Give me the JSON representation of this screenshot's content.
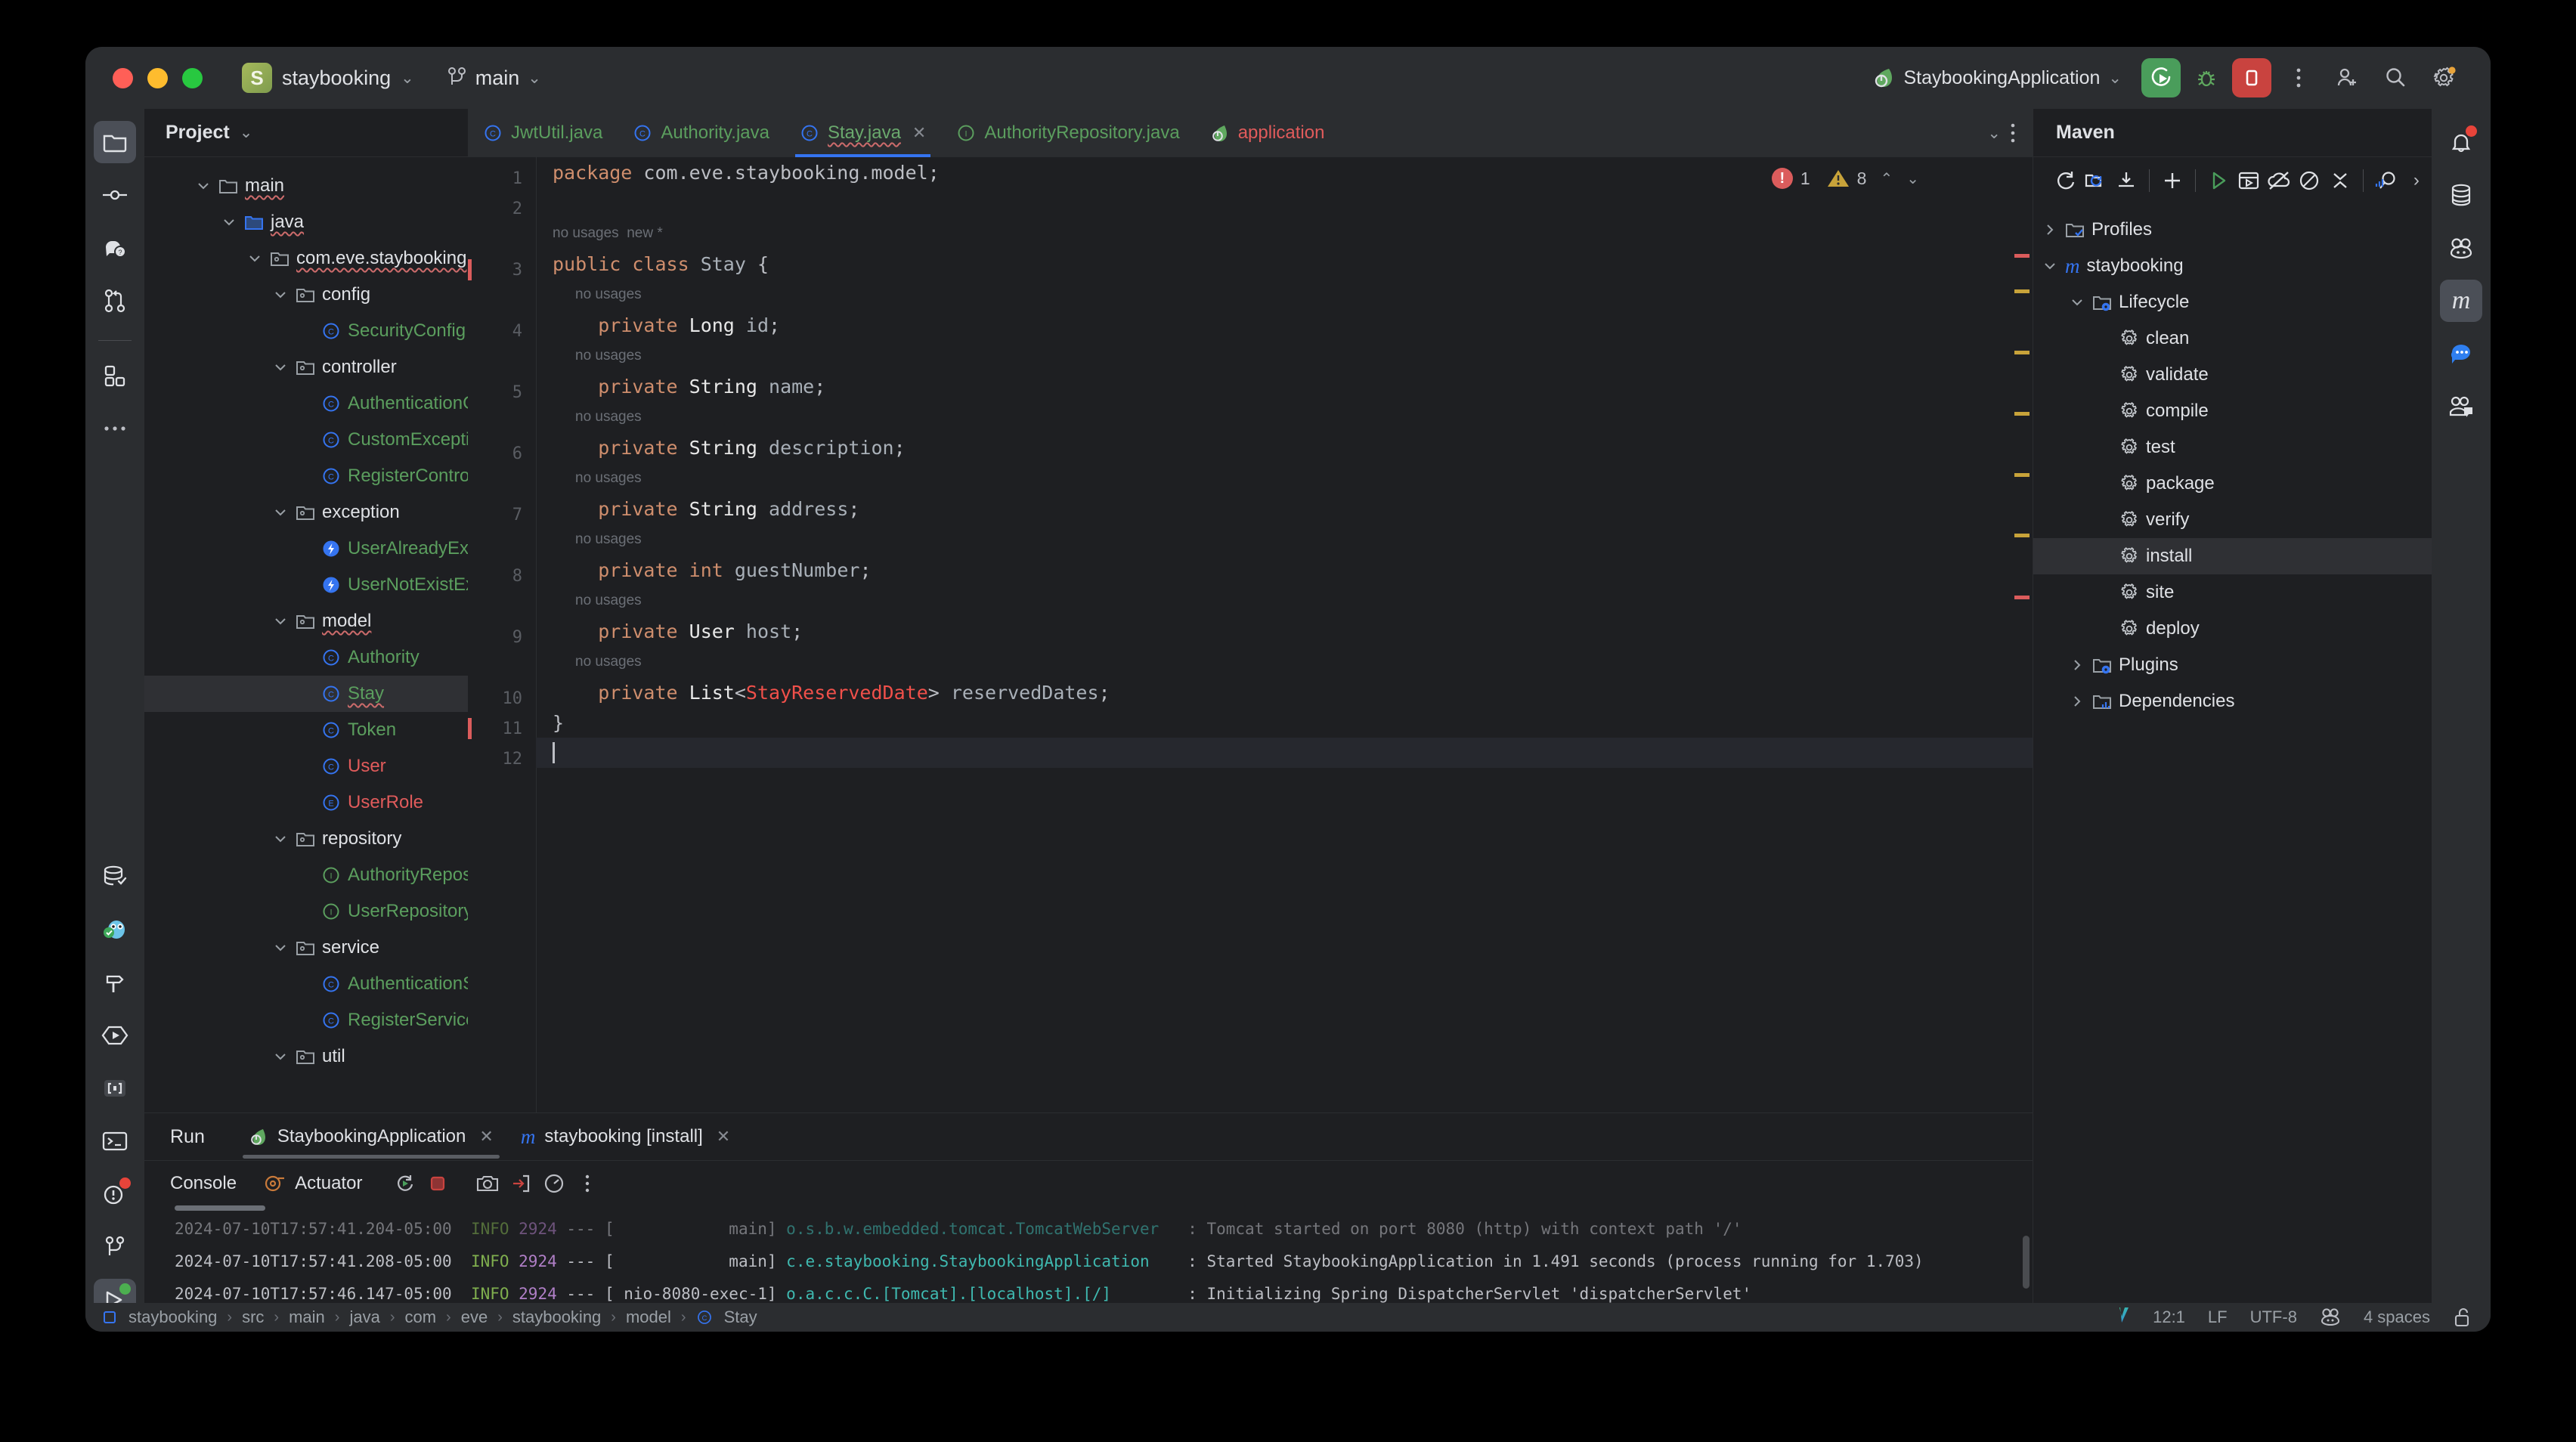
{
  "window": {
    "project_name": "staybooking",
    "project_badge": "S",
    "branch": "main",
    "run_config": "StaybookingApplication"
  },
  "titlebar": {
    "icons": [
      {
        "name": "run-button",
        "label": "Run"
      },
      {
        "name": "debug-button",
        "label": "Debug"
      },
      {
        "name": "stop-button",
        "label": "Stop"
      },
      {
        "name": "more-actions-button",
        "label": "More"
      },
      {
        "name": "add-collaborator-icon",
        "label": "Code With Me"
      },
      {
        "name": "search-everywhere-icon",
        "label": "Search"
      },
      {
        "name": "settings-icon",
        "label": "Settings"
      }
    ]
  },
  "left_activity_bar": {
    "items": [
      {
        "name": "project-tool-icon",
        "label": "Project",
        "active": true
      },
      {
        "name": "commit-tool-icon",
        "label": "Commit",
        "active": false
      },
      {
        "name": "ai-assistant-icon",
        "label": "AI Assistant",
        "active": false
      },
      {
        "name": "pull-requests-icon",
        "label": "Pull Requests",
        "active": false
      },
      {
        "name": "structure-icon",
        "label": "Structure",
        "active": false
      },
      {
        "name": "more-tool-windows-icon",
        "label": "More Tool Windows",
        "active": false
      },
      {
        "name": "database-icon",
        "label": "Database",
        "active": false
      },
      {
        "name": "endpoints-icon",
        "label": "Endpoints",
        "active": false
      },
      {
        "name": "build-icon",
        "label": "Build",
        "active": false
      },
      {
        "name": "services-icon",
        "label": "Services",
        "active": false
      },
      {
        "name": "bookmarks-icon",
        "label": "Bookmarks",
        "active": false
      },
      {
        "name": "terminal-icon",
        "label": "Terminal",
        "active": false
      },
      {
        "name": "problems-icon",
        "label": "Problems",
        "active": false
      },
      {
        "name": "version-control-icon",
        "label": "Version Control",
        "active": false
      },
      {
        "name": "run-tool-icon",
        "label": "Run",
        "active": true
      }
    ]
  },
  "right_activity_bar": {
    "items": [
      {
        "name": "notifications-icon",
        "label": "Notifications",
        "active": false
      },
      {
        "name": "database-panel-icon",
        "label": "Database",
        "active": false
      },
      {
        "name": "bot-icon",
        "label": "Assistant",
        "active": false
      },
      {
        "name": "maven-panel-icon",
        "label": "Maven",
        "active": true
      },
      {
        "name": "chat-icon",
        "label": "Chat",
        "active": false
      },
      {
        "name": "ai-chat-icon",
        "label": "AI Chat",
        "active": false
      }
    ]
  },
  "project_panel": {
    "title": "Project",
    "tree": [
      {
        "label": "main",
        "icon": "folder",
        "depth": 2,
        "expanded": true,
        "color": "white",
        "squiggle": true
      },
      {
        "label": "java",
        "icon": "folder-source",
        "depth": 3,
        "expanded": true,
        "color": "white",
        "squiggle": true
      },
      {
        "label": "com.eve.staybooking",
        "icon": "package",
        "depth": 4,
        "expanded": true,
        "color": "white",
        "squiggle": true
      },
      {
        "label": "config",
        "icon": "package",
        "depth": 5,
        "expanded": true,
        "color": "white",
        "squiggle": false
      },
      {
        "label": "SecurityConfig",
        "icon": "class",
        "depth": 6,
        "color": "green",
        "squiggle": false
      },
      {
        "label": "controller",
        "icon": "package",
        "depth": 5,
        "expanded": true,
        "color": "white",
        "squiggle": false
      },
      {
        "label": "AuthenticationController",
        "icon": "class",
        "depth": 6,
        "color": "green",
        "squiggle": false
      },
      {
        "label": "CustomExceptionHandler",
        "icon": "class",
        "depth": 6,
        "color": "green",
        "squiggle": false
      },
      {
        "label": "RegisterController",
        "icon": "class",
        "depth": 6,
        "color": "green",
        "squiggle": false
      },
      {
        "label": "exception",
        "icon": "package",
        "depth": 5,
        "expanded": true,
        "color": "white",
        "squiggle": false
      },
      {
        "label": "UserAlreadyExistException",
        "icon": "exception",
        "depth": 6,
        "color": "green",
        "squiggle": false
      },
      {
        "label": "UserNotExistException",
        "icon": "exception",
        "depth": 6,
        "color": "green",
        "squiggle": false
      },
      {
        "label": "model",
        "icon": "package",
        "depth": 5,
        "expanded": true,
        "color": "white",
        "squiggle": true
      },
      {
        "label": "Authority",
        "icon": "class",
        "depth": 6,
        "color": "green",
        "squiggle": false
      },
      {
        "label": "Stay",
        "icon": "class",
        "depth": 6,
        "color": "green",
        "squiggle": true,
        "selected": true
      },
      {
        "label": "Token",
        "icon": "class",
        "depth": 6,
        "color": "green",
        "squiggle": false
      },
      {
        "label": "User",
        "icon": "class",
        "depth": 6,
        "color": "red",
        "squiggle": false
      },
      {
        "label": "UserRole",
        "icon": "enum",
        "depth": 6,
        "color": "red",
        "squiggle": false
      },
      {
        "label": "repository",
        "icon": "package",
        "depth": 5,
        "expanded": true,
        "color": "white",
        "squiggle": false
      },
      {
        "label": "AuthorityRepository",
        "icon": "interface",
        "depth": 6,
        "color": "green",
        "squiggle": false
      },
      {
        "label": "UserRepository",
        "icon": "interface",
        "depth": 6,
        "color": "green",
        "squiggle": false
      },
      {
        "label": "service",
        "icon": "package",
        "depth": 5,
        "expanded": true,
        "color": "white",
        "squiggle": false
      },
      {
        "label": "AuthenticationService",
        "icon": "class",
        "depth": 6,
        "color": "green",
        "squiggle": false
      },
      {
        "label": "RegisterService",
        "icon": "class",
        "depth": 6,
        "color": "green",
        "squiggle": false
      },
      {
        "label": "util",
        "icon": "package",
        "depth": 5,
        "expanded": true,
        "color": "white",
        "squiggle": false
      }
    ]
  },
  "editor": {
    "tabs": [
      {
        "label": "JwtUtil.java",
        "icon": "class",
        "active": false,
        "closable": false,
        "color": "green"
      },
      {
        "label": "Authority.java",
        "icon": "class",
        "active": false,
        "closable": false,
        "color": "green"
      },
      {
        "label": "Stay.java",
        "icon": "class",
        "active": true,
        "closable": true,
        "color": "green",
        "squiggle": true
      },
      {
        "label": "AuthorityRepository.java",
        "icon": "interface",
        "active": false,
        "closable": false,
        "color": "green"
      },
      {
        "label": "application",
        "icon": "spring",
        "active": false,
        "closable": false,
        "color": "red"
      }
    ],
    "inspection": {
      "errors": "1",
      "warnings": "8"
    },
    "lines": [
      {
        "num": "1",
        "tokens": [
          {
            "t": "package",
            "c": "kw"
          },
          {
            "t": " com.eve.staybooking.model;",
            "c": "pl"
          }
        ]
      },
      {
        "num": "2",
        "tokens": []
      },
      {
        "hint": "no usages  new *",
        "indent": 0
      },
      {
        "num": "3",
        "tokens": [
          {
            "t": "public class",
            "c": "kw"
          },
          {
            "t": " ",
            "c": "pl"
          },
          {
            "t": "Stay",
            "c": "id"
          },
          {
            "t": " {",
            "c": "pl"
          }
        ],
        "error_marker": true
      },
      {
        "hint": "no usages",
        "indent": 1
      },
      {
        "num": "4",
        "tokens": [
          {
            "t": "    ",
            "c": "pl"
          },
          {
            "t": "private",
            "c": "kw"
          },
          {
            "t": " ",
            "c": "pl"
          },
          {
            "t": "Long",
            "c": "ty"
          },
          {
            "t": " ",
            "c": "pl"
          },
          {
            "t": "id",
            "c": "id"
          },
          {
            "t": ";",
            "c": "pl"
          }
        ]
      },
      {
        "hint": "no usages",
        "indent": 1
      },
      {
        "num": "5",
        "tokens": [
          {
            "t": "    ",
            "c": "pl"
          },
          {
            "t": "private",
            "c": "kw"
          },
          {
            "t": " ",
            "c": "pl"
          },
          {
            "t": "String",
            "c": "ty"
          },
          {
            "t": " ",
            "c": "pl"
          },
          {
            "t": "name",
            "c": "id"
          },
          {
            "t": ";",
            "c": "pl"
          }
        ]
      },
      {
        "hint": "no usages",
        "indent": 1
      },
      {
        "num": "6",
        "tokens": [
          {
            "t": "    ",
            "c": "pl"
          },
          {
            "t": "private",
            "c": "kw"
          },
          {
            "t": " ",
            "c": "pl"
          },
          {
            "t": "String",
            "c": "ty"
          },
          {
            "t": " ",
            "c": "pl"
          },
          {
            "t": "description",
            "c": "id"
          },
          {
            "t": ";",
            "c": "pl"
          }
        ]
      },
      {
        "hint": "no usages",
        "indent": 1
      },
      {
        "num": "7",
        "tokens": [
          {
            "t": "    ",
            "c": "pl"
          },
          {
            "t": "private",
            "c": "kw"
          },
          {
            "t": " ",
            "c": "pl"
          },
          {
            "t": "String",
            "c": "ty"
          },
          {
            "t": " ",
            "c": "pl"
          },
          {
            "t": "address",
            "c": "id"
          },
          {
            "t": ";",
            "c": "pl"
          }
        ]
      },
      {
        "hint": "no usages",
        "indent": 1
      },
      {
        "num": "8",
        "tokens": [
          {
            "t": "    ",
            "c": "pl"
          },
          {
            "t": "private",
            "c": "kw"
          },
          {
            "t": " ",
            "c": "pl"
          },
          {
            "t": "int",
            "c": "kw"
          },
          {
            "t": " ",
            "c": "pl"
          },
          {
            "t": "guestNumber",
            "c": "id"
          },
          {
            "t": ";",
            "c": "pl"
          }
        ]
      },
      {
        "hint": "no usages",
        "indent": 1
      },
      {
        "num": "9",
        "tokens": [
          {
            "t": "    ",
            "c": "pl"
          },
          {
            "t": "private",
            "c": "kw"
          },
          {
            "t": " ",
            "c": "pl"
          },
          {
            "t": "User",
            "c": "ty"
          },
          {
            "t": " ",
            "c": "pl"
          },
          {
            "t": "host",
            "c": "id"
          },
          {
            "t": ";",
            "c": "pl"
          }
        ]
      },
      {
        "hint": "no usages",
        "indent": 1
      },
      {
        "num": "10",
        "tokens": [
          {
            "t": "    ",
            "c": "pl"
          },
          {
            "t": "private",
            "c": "kw"
          },
          {
            "t": " ",
            "c": "pl"
          },
          {
            "t": "List",
            "c": "ty"
          },
          {
            "t": "<",
            "c": "pl"
          },
          {
            "t": "StayReservedDate",
            "c": "err"
          },
          {
            "t": "> ",
            "c": "pl"
          },
          {
            "t": "reservedDates",
            "c": "id"
          },
          {
            "t": ";",
            "c": "pl"
          }
        ]
      },
      {
        "num": "11",
        "tokens": [
          {
            "t": "}",
            "c": "pl"
          }
        ],
        "error_marker": true
      },
      {
        "num": "12",
        "tokens": [],
        "caret": true,
        "current": true
      }
    ]
  },
  "maven": {
    "title": "Maven",
    "toolbar": [
      {
        "name": "reload-all-projects-icon",
        "label": "Reload All Maven Projects"
      },
      {
        "name": "generate-sources-icon",
        "label": "Generate Sources"
      },
      {
        "name": "download-sources-icon",
        "label": "Download Sources"
      },
      {
        "name": "add-maven-project-icon",
        "label": "Add Maven Project"
      },
      {
        "name": "run-maven-build-icon",
        "label": "Run Maven Build"
      },
      {
        "name": "execute-goal-icon",
        "label": "Execute Maven Goal"
      },
      {
        "name": "toggle-offline-icon",
        "label": "Toggle Offline Mode"
      },
      {
        "name": "skip-tests-icon",
        "label": "Skip Tests"
      },
      {
        "name": "collapse-all-icon",
        "label": "Collapse All"
      },
      {
        "name": "show-dependencies-icon",
        "label": "Show Dependencies"
      },
      {
        "name": "more-maven-actions-icon",
        "label": "More"
      }
    ],
    "tree": [
      {
        "label": "Profiles",
        "icon": "folder-check",
        "depth": 0,
        "expanded": false
      },
      {
        "label": "staybooking",
        "icon": "maven-m",
        "depth": 0,
        "expanded": true
      },
      {
        "label": "Lifecycle",
        "icon": "folder-gear",
        "depth": 1,
        "expanded": true
      },
      {
        "label": "clean",
        "icon": "gear",
        "depth": 2
      },
      {
        "label": "validate",
        "icon": "gear",
        "depth": 2
      },
      {
        "label": "compile",
        "icon": "gear",
        "depth": 2
      },
      {
        "label": "test",
        "icon": "gear",
        "depth": 2
      },
      {
        "label": "package",
        "icon": "gear",
        "depth": 2
      },
      {
        "label": "verify",
        "icon": "gear",
        "depth": 2
      },
      {
        "label": "install",
        "icon": "gear",
        "depth": 2,
        "selected": true
      },
      {
        "label": "site",
        "icon": "gear",
        "depth": 2
      },
      {
        "label": "deploy",
        "icon": "gear",
        "depth": 2
      },
      {
        "label": "Plugins",
        "icon": "folder-gear",
        "depth": 1,
        "expanded": false
      },
      {
        "label": "Dependencies",
        "icon": "folder-deps",
        "depth": 1,
        "expanded": false
      }
    ]
  },
  "run_panel": {
    "label": "Run",
    "tabs": [
      {
        "label": "StaybookingApplication",
        "icon": "spring",
        "active": true,
        "closable": true
      },
      {
        "label": "staybooking [install]",
        "icon": "maven-m",
        "active": false,
        "closable": true
      }
    ],
    "console_bar": {
      "console_label": "Console",
      "actuator_label": "Actuator",
      "buttons": [
        {
          "name": "rerun-button",
          "label": "Rerun"
        },
        {
          "name": "stop-button",
          "label": "Stop"
        },
        {
          "name": "screenshot-button",
          "label": "Screenshot"
        },
        {
          "name": "export-button",
          "label": "Export"
        },
        {
          "name": "profile-button",
          "label": "Profile"
        },
        {
          "name": "more-console-actions-button",
          "label": "More"
        }
      ]
    },
    "log_lines": [
      {
        "time": "2024-07-10T17:57:41.204-05:00",
        "level": "INFO",
        "pid": "2924",
        "thread": "main",
        "logger": "o.s.b.w.embedded.tomcat.TomcatWebServer",
        "message": ": Tomcat started on port 8080 (http) with context path '/'",
        "partial": true
      },
      {
        "time": "2024-07-10T17:57:41.208-05:00",
        "level": "INFO",
        "pid": "2924",
        "thread": "main",
        "logger": "c.e.staybooking.StaybookingApplication",
        "message": ": Started StaybookingApplication in 1.491 seconds (process running for 1.703)",
        "partial": false
      },
      {
        "time": "2024-07-10T17:57:46.147-05:00",
        "level": "INFO",
        "pid": "2924",
        "thread": "nio-8080-exec-1",
        "logger": "o.a.c.c.C.[Tomcat].[localhost].[/]",
        "message": ": Initializing Spring DispatcherServlet 'dispatcherServlet'",
        "partial": false
      }
    ]
  },
  "status_bar": {
    "breadcrumb": [
      "staybooking",
      "src",
      "main",
      "java",
      "com",
      "eve",
      "staybooking",
      "model",
      "Stay"
    ],
    "caret_position": "12:1",
    "line_separator": "LF",
    "encoding": "UTF-8",
    "indent": "4 spaces"
  },
  "colors": {
    "accent_blue": "#3574f0",
    "run_green": "#4a9d5b",
    "stop_red": "#c9433f",
    "error_red": "#f0504a",
    "warning_yellow": "#c8a33a",
    "class_green": "#5b9e5e",
    "modified_red": "#e05b5b",
    "keyword_orange": "#cf8e6d",
    "panel_bg": "#1e1f22",
    "chrome_bg": "#2b2d30"
  }
}
